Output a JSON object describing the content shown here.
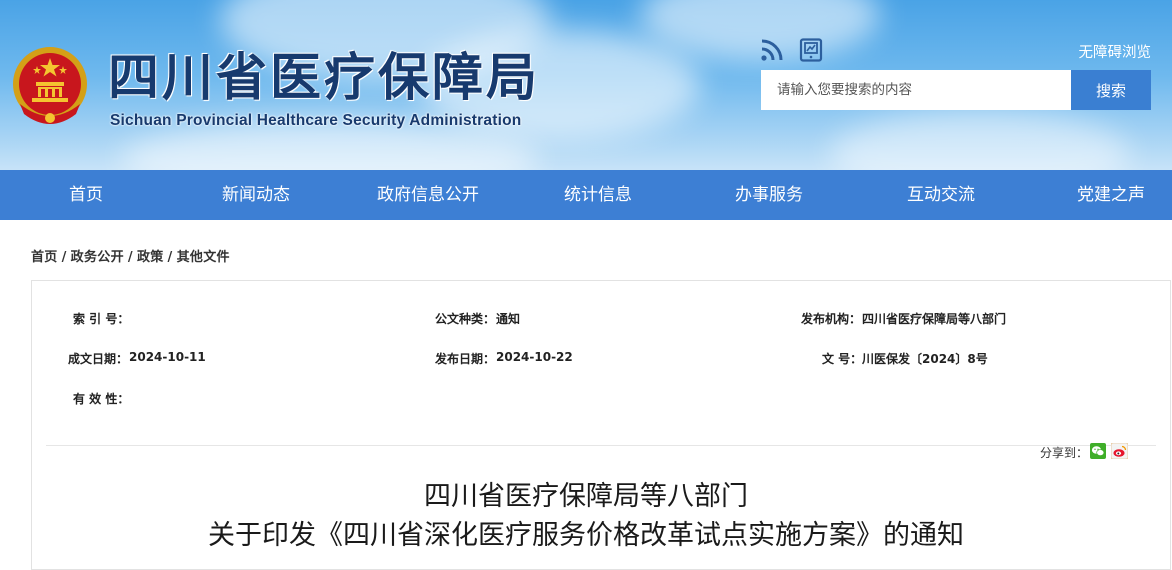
{
  "header": {
    "site_title": "四川省医疗保障局",
    "site_subtitle": "Sichuan Provincial Healthcare Security Administration",
    "accessible_link": "无障碍浏览",
    "search_placeholder": "请输入您要搜索的内容",
    "search_button": "搜索",
    "icons": [
      "emblem-icon",
      "rss-icon",
      "mobile-icon"
    ]
  },
  "nav": {
    "items": [
      "首页",
      "新闻动态",
      "政府信息公开",
      "统计信息",
      "办事服务",
      "互动交流",
      "党建之声"
    ]
  },
  "breadcrumb": {
    "items": [
      "首页",
      "政务公开",
      "政策",
      "其他文件"
    ],
    "separator": "/"
  },
  "doc_meta": {
    "index_label": "索 引 号：",
    "index_value": "",
    "category_label": "公文种类：",
    "category_value": "通知",
    "issuer_label": "发布机构：",
    "issuer_value": "四川省医疗保障局等八部门",
    "written_date_label": "成文日期：",
    "written_date_value": "2024-10-11",
    "publish_date_label": "发布日期：",
    "publish_date_value": "2024-10-22",
    "doc_number_label": "文 号：",
    "doc_number_value": "川医保发〔2024〕8号",
    "validity_label": "有 效 性：",
    "validity_value": ""
  },
  "share": {
    "label": "分享到：",
    "icons": [
      "wechat-icon",
      "weibo-icon"
    ]
  },
  "article": {
    "title_line1": "四川省医疗保障局等八部门",
    "title_line2": "关于印发《四川省深化医疗服务价格改革试点实施方案》的通知"
  },
  "colors": {
    "nav_bg": "#3d7fd4",
    "search_button_bg": "#3a7fd2",
    "title_text": "#173a6e",
    "banner_sky": "#6fb9ee"
  }
}
